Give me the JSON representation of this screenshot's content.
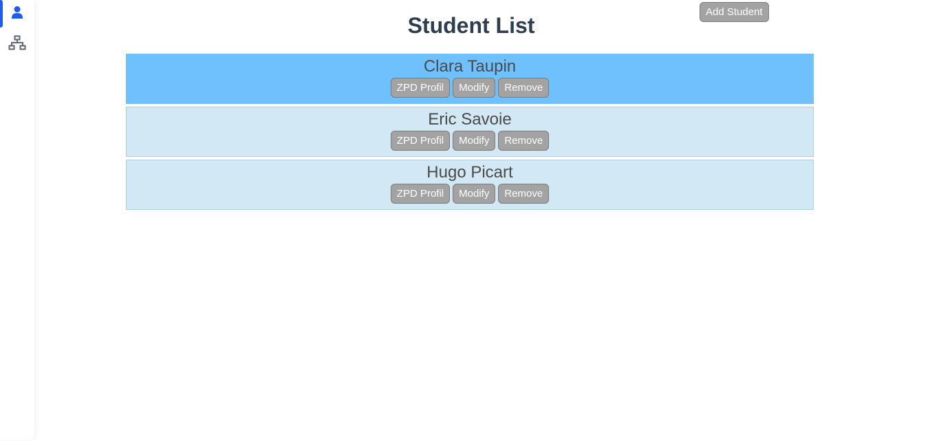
{
  "page": {
    "title": "Student List"
  },
  "toolbar": {
    "add_label": "Add Student"
  },
  "sidebar": {
    "items": [
      {
        "name": "students",
        "icon": "user-icon",
        "active": true
      },
      {
        "name": "hierarchy",
        "icon": "sitemap-icon",
        "active": false
      }
    ],
    "accent": "#1f5af2"
  },
  "students": [
    {
      "name": "Clara Taupin",
      "selected": true,
      "zpd": "ZPD Profil",
      "modify": "Modify",
      "remove": "Remove"
    },
    {
      "name": "Eric Savoie",
      "selected": false,
      "zpd": "ZPD Profil",
      "modify": "Modify",
      "remove": "Remove"
    },
    {
      "name": "Hugo Picart",
      "selected": false,
      "zpd": "ZPD Profil",
      "modify": "Modify",
      "remove": "Remove"
    }
  ],
  "colors": {
    "selected_row": "#6ec1fd",
    "row": "#d2e8f4",
    "button": "#a3a3a3",
    "title": "#2c3e50"
  }
}
